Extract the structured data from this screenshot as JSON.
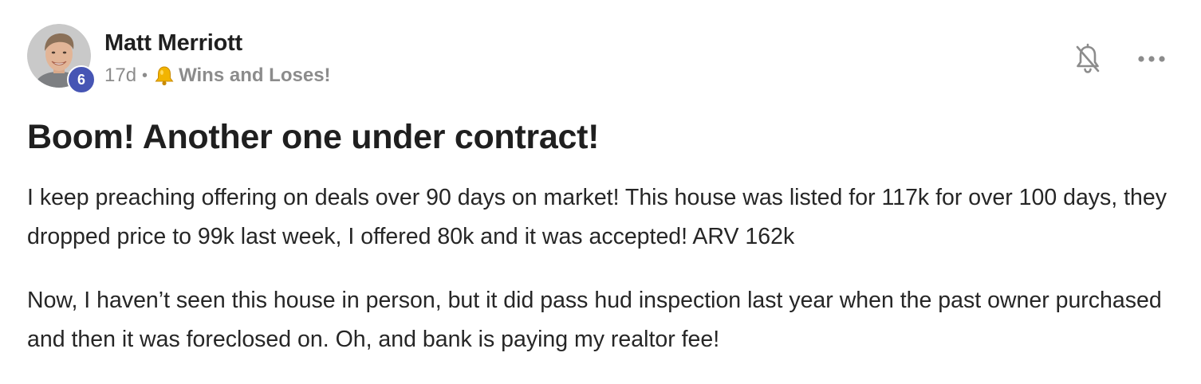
{
  "post": {
    "author": "Matt Merriott",
    "level": "6",
    "time_ago": "17d",
    "separator": "•",
    "category_icon": "bell-emoji",
    "category": "Wins and Loses!",
    "title": "Boom! Another one under contract!",
    "paragraphs": [
      "I keep preaching offering on deals over 90 days on market! This house was listed for 117k for over 100 days, they dropped price to 99k last week, I offered 80k and it was accepted! ARV 162k",
      "Now, I haven’t seen this house in person, but it did pass hud inspection last year when the past owner purchased and then it was foreclosed on. Oh, and bank is paying my realtor fee!"
    ]
  },
  "actions": {
    "notify_icon": "bell-off-icon",
    "more_icon": "more-horizontal-icon"
  },
  "colors": {
    "level_badge": "#4655b4",
    "text_primary": "#1f1f1f",
    "text_muted": "#8c8c8c",
    "bell_emoji": "#f2b400"
  }
}
